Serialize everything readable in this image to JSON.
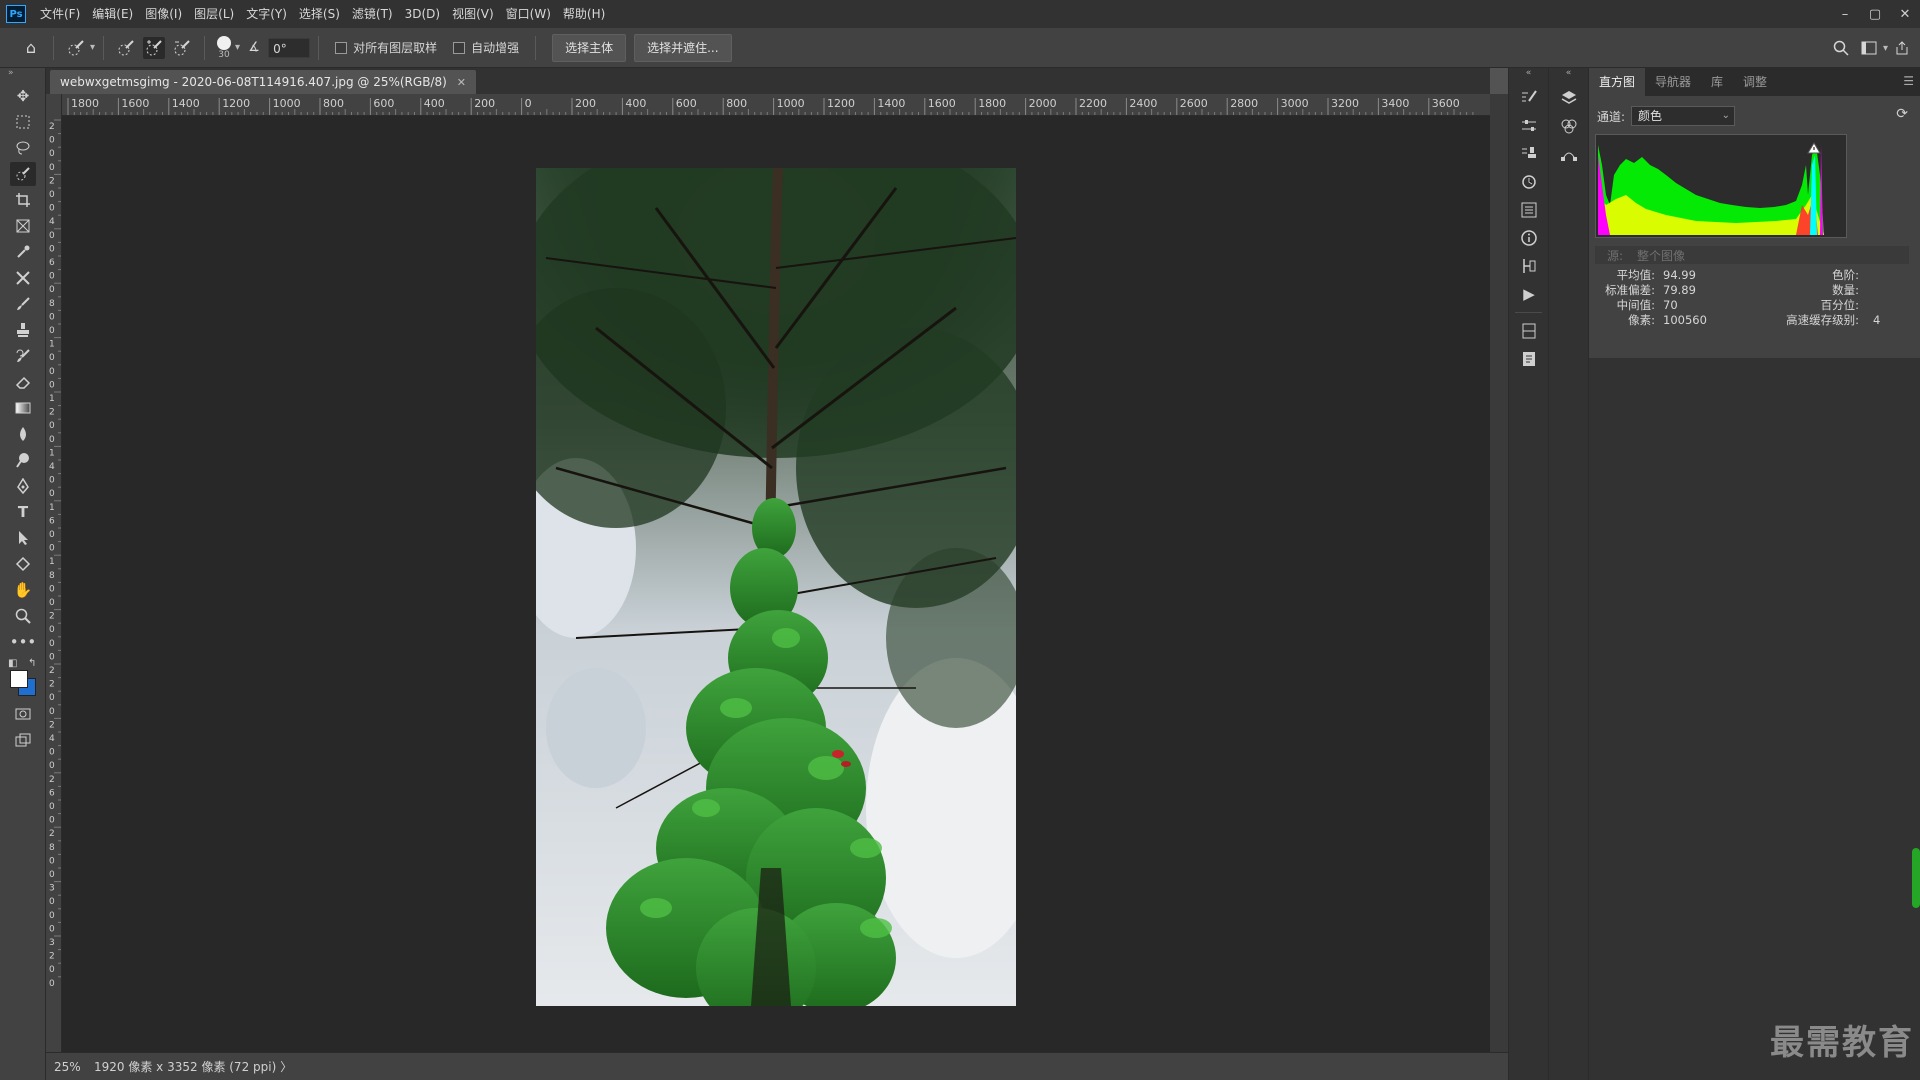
{
  "app": {
    "logo": "Ps",
    "menu": [
      "文件(F)",
      "编辑(E)",
      "图像(I)",
      "图层(L)",
      "文字(Y)",
      "选择(S)",
      "滤镜(T)",
      "3D(D)",
      "视图(V)",
      "窗口(W)",
      "帮助(H)"
    ],
    "window_controls": [
      "–",
      "▢",
      "✕"
    ]
  },
  "options": {
    "brush_size": "30",
    "angle_value": "0°",
    "sample_all_layers": "对所有图层取样",
    "auto_enhance": "自动增强",
    "select_subject": "选择主体",
    "select_and_mask": "选择并遮住..."
  },
  "document": {
    "tab_title": "webwxgetmsgimg - 2020-06-08T114916.407.jpg @ 25%(RGB/8)",
    "close": "✕",
    "ruler_h": [
      "1800",
      "1600",
      "1400",
      "1200",
      "1000",
      "800",
      "600",
      "400",
      "200",
      "0",
      "200",
      "400",
      "600",
      "800",
      "1000",
      "1200",
      "1400",
      "1600",
      "1800",
      "2000",
      "2200",
      "2400",
      "2600",
      "2800",
      "3000",
      "3200",
      "3400",
      "3600"
    ],
    "ruler_v": [
      "2",
      "0",
      "0",
      "0",
      "2",
      "0",
      "0",
      "4",
      "0",
      "0",
      "6",
      "0",
      "0",
      "8",
      "0",
      "0",
      "1",
      "0",
      "0",
      "0",
      "1",
      "2",
      "0",
      "0",
      "1",
      "4",
      "0",
      "0",
      "1",
      "6",
      "0",
      "0",
      "1",
      "8",
      "0",
      "0",
      "2",
      "0",
      "0",
      "0",
      "2",
      "2",
      "0",
      "0",
      "2",
      "4",
      "0",
      "0",
      "2",
      "6",
      "0",
      "0",
      "2",
      "8",
      "0",
      "0",
      "3",
      "0",
      "0",
      "0",
      "3",
      "2",
      "0",
      "0"
    ]
  },
  "status": {
    "zoom": "25%",
    "info": "1920 像素 x 3352 像素 (72 ppi)",
    "arrow": "〉"
  },
  "panel": {
    "tabs": [
      "直方图",
      "导航器",
      "库",
      "调整"
    ],
    "active_tab": "直方图",
    "channel_label": "通道:",
    "channel_value": "颜色",
    "source_label": "源:",
    "source_value": "整个图像",
    "stats": [
      {
        "label": "平均值:",
        "value": "94.99",
        "label2": "色阶:",
        "value2": ""
      },
      {
        "label": "标准偏差:",
        "value": "79.89",
        "label2": "数量:",
        "value2": ""
      },
      {
        "label": "中间值:",
        "value": "70",
        "label2": "百分位:",
        "value2": ""
      },
      {
        "label": "像素:",
        "value": "100560",
        "label2": "高速缓存级别:",
        "value2": "4"
      }
    ]
  },
  "watermark": "最需教育",
  "colors": {
    "foreground": "#ffffff",
    "background": "#1f6fd1",
    "accent": "#31a8ff"
  }
}
